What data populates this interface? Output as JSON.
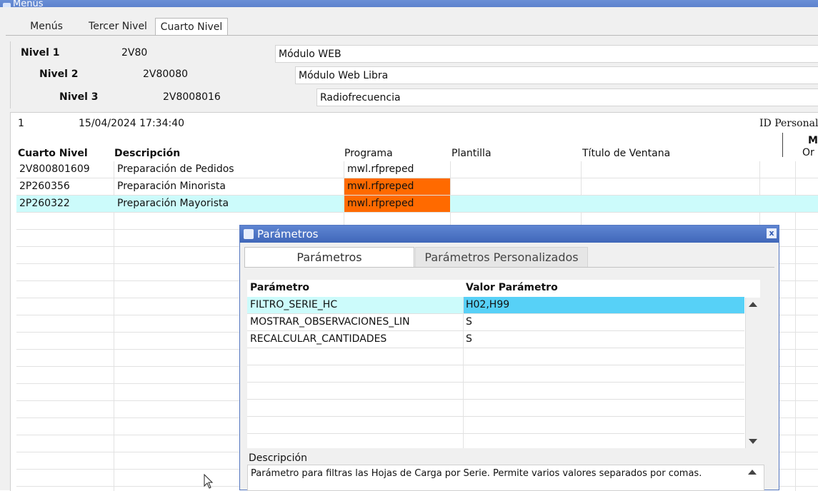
{
  "window": {
    "title": "Menús"
  },
  "tabs": [
    "Menús",
    "Tercer Nivel",
    "Cuarto Nivel"
  ],
  "levels": [
    {
      "label": "Nivel 1",
      "code": "2V80",
      "desc": "Módulo WEB"
    },
    {
      "label": "Nivel 2",
      "code": "2V80080",
      "desc": "Módulo Web Libra"
    },
    {
      "label": "Nivel 3",
      "code": "2V8008016",
      "desc": "Radiofrecuencia"
    }
  ],
  "record": {
    "number": "1",
    "timestamp": "15/04/2024 17:34:40",
    "id_label": "ID Personal",
    "m_label": "M",
    "or_label": "Or"
  },
  "grid": {
    "headers": {
      "cuarto_nivel": "Cuarto Nivel",
      "descripcion": "Descripción",
      "programa": "Programa",
      "plantilla": "Plantilla",
      "titulo": "Título de Ventana"
    },
    "rows": [
      {
        "code": "2V800801609",
        "desc": "Preparación de Pedidos",
        "programa": "mwl.rfpreped",
        "highlight": false,
        "orange": false
      },
      {
        "code": "2P260356",
        "desc": "Preparación Minorista",
        "programa": "mwl.rfpreped",
        "highlight": false,
        "orange": true
      },
      {
        "code": "2P260322",
        "desc": "Preparación Mayorista",
        "programa": "mwl.rfpreped",
        "highlight": true,
        "orange": true
      }
    ]
  },
  "dialog": {
    "title": "Parámetros",
    "close_label": "x",
    "tabs": [
      "Parámetros",
      "Parámetros Personalizados"
    ],
    "headers": {
      "param": "Parámetro",
      "value": "Valor Parámetro"
    },
    "rows": [
      {
        "param": "FILTRO_SERIE_HC",
        "value": "H02,H99",
        "selected": true
      },
      {
        "param": "MOSTRAR_OBSERVACIONES_LIN",
        "value": "S",
        "selected": false
      },
      {
        "param": "RECALCULAR_CANTIDADES",
        "value": "S",
        "selected": false
      }
    ],
    "desc_label": "Descripción",
    "desc_text": "Parámetro para filtras las Hojas de Carga por Serie. Permite varios valores separados por comas."
  },
  "colors": {
    "accent": "#4a6fc0",
    "row_highlight": "#ccfbfb",
    "orange": "#ff6a00",
    "selected_value": "#57d1f7"
  }
}
